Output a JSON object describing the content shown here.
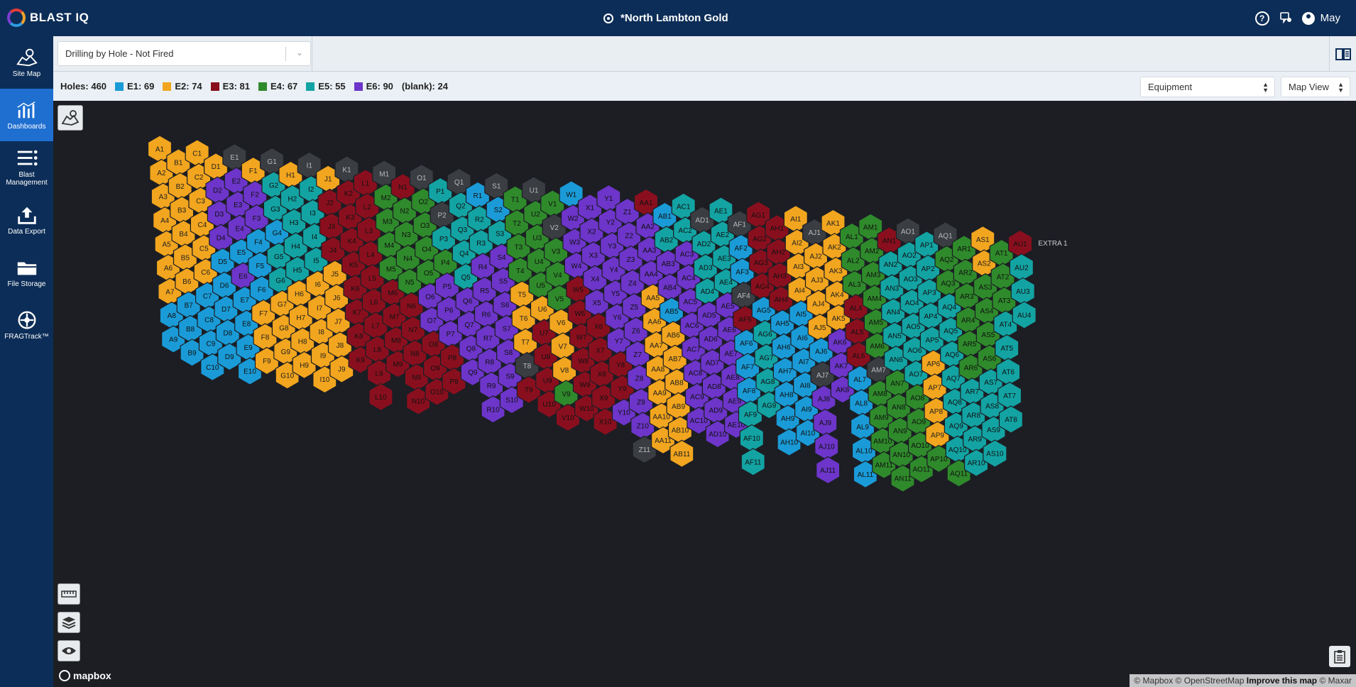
{
  "app": {
    "logo_text": "BLAST IQ",
    "site_title": "*North Lambton Gold",
    "user_name": "May"
  },
  "sidebar": {
    "items": [
      {
        "label": "Site Map",
        "icon": "map-icon",
        "active": false
      },
      {
        "label": "Dashboards",
        "icon": "chart-icon",
        "active": true
      },
      {
        "label": "Blast Management",
        "icon": "list-icon",
        "active": false
      },
      {
        "label": "Data Export",
        "icon": "upload-icon",
        "active": false
      },
      {
        "label": "File Storage",
        "icon": "folder-icon",
        "active": false
      },
      {
        "label": "FRAGTrack™",
        "icon": "target-icon",
        "active": false
      }
    ]
  },
  "toolbar": {
    "report": "Drilling by Hole - Not Fired"
  },
  "legend": {
    "holes": "Holes: 460",
    "items": [
      {
        "label": "E1: 69",
        "color": "#1a9bd7"
      },
      {
        "label": "E2: 74",
        "color": "#f2a51e"
      },
      {
        "label": "E3: 81",
        "color": "#8a0f1e"
      },
      {
        "label": "E4: 67",
        "color": "#2f8a2b"
      },
      {
        "label": "E5: 55",
        "color": "#13a3a3"
      },
      {
        "label": "E6: 90",
        "color": "#6d35c9"
      }
    ],
    "blank": "(blank): 24"
  },
  "selects": {
    "group": "Equipment",
    "view": "Map View"
  },
  "map": {
    "attribution": "© Mapbox © OpenStreetMap",
    "improve": "Improve this map",
    "maxar": "© Maxar",
    "mapbox_logo": "mapbox",
    "blank_color": "#3a3d42",
    "extra_label": "EXTRA 1",
    "rows": [
      {
        "p": "A",
        "n": 9,
        "s": "2222222111"
      },
      {
        "p": "B",
        "n": 9,
        "s": "2222221111"
      },
      {
        "p": "C",
        "n": 10,
        "s": "2222221111"
      },
      {
        "p": "D",
        "n": 9,
        "s": "2666111111"
      },
      {
        "p": "E",
        "n": 10,
        "s": "0666161111"
      },
      {
        "p": "F",
        "n": 9,
        "s": "2661112221"
      },
      {
        "p": "G",
        "n": 10,
        "s": "0551552222"
      },
      {
        "p": "H",
        "n": 9,
        "s": "2555522222"
      },
      {
        "p": "I",
        "n": 10,
        "s": "0555522222"
      },
      {
        "p": "J",
        "n": 9,
        "s": "2333222222"
      },
      {
        "p": "K",
        "n": 9,
        "s": "0333333333"
      },
      {
        "p": "L",
        "n": 10,
        "s": "3333333333"
      },
      {
        "p": "M",
        "n": 9,
        "s": "0444433333"
      },
      {
        "p": "N",
        "n": 10,
        "s": "3444433333"
      },
      {
        "p": "O",
        "n": 10,
        "s": "0444466333"
      },
      {
        "p": "P",
        "n": 9,
        "s": "5054666333"
      },
      {
        "p": "Q",
        "n": 9,
        "s": "0555566666"
      },
      {
        "p": "R",
        "n": 10,
        "s": "1556666666"
      },
      {
        "p": "S",
        "n": 10,
        "s": "0156666666"
      },
      {
        "p": "T",
        "n": 9,
        "s": "4444222033"
      },
      {
        "p": "U",
        "n": 10,
        "s": "0444423333"
      },
      {
        "p": "V",
        "n": 10,
        "s": "4044422243"
      },
      {
        "p": "W",
        "n": 10,
        "s": "1666333333"
      },
      {
        "p": "X",
        "n": 10,
        "s": "6666633333"
      },
      {
        "p": "Y",
        "n": 10,
        "s": "6666666336"
      },
      {
        "p": "Z",
        "n": 11,
        "s": "66666666660"
      },
      {
        "p": "AA",
        "n": 11,
        "s": "36662222222"
      },
      {
        "p": "AB",
        "n": 11,
        "s": "15661222222"
      },
      {
        "p": "AC",
        "n": 10,
        "s": "5566666666"
      },
      {
        "p": "AD",
        "n": 10,
        "s": "0555666666"
      },
      {
        "p": "AE",
        "n": 10,
        "s": "5555666666"
      },
      {
        "p": "AF",
        "n": 11,
        "s": "01103111555"
      },
      {
        "p": "AG",
        "n": 9,
        "s": "3333155555"
      },
      {
        "p": "AH",
        "n": 10,
        "s": "3333111111"
      },
      {
        "p": "AI",
        "n": 10,
        "s": "2222111111"
      },
      {
        "p": "AJ",
        "n": 11,
        "s": "02222106666"
      },
      {
        "p": "AK",
        "n": 8,
        "s": "2222266666"
      },
      {
        "p": "AL",
        "n": 11,
        "s": "44433311111"
      },
      {
        "p": "AM",
        "n": 11,
        "s": "44444404444"
      },
      {
        "p": "AN",
        "n": 11,
        "s": "35555544444"
      },
      {
        "p": "AO",
        "n": 11,
        "s": "05555554444"
      },
      {
        "p": "AP",
        "n": 10,
        "s": "5555522224"
      },
      {
        "p": "AQ",
        "n": 11,
        "s": "04455555554"
      },
      {
        "p": "AR",
        "n": 10,
        "s": "4444445555"
      },
      {
        "p": "AS",
        "n": 10,
        "s": "2244445555"
      },
      {
        "p": "AT",
        "n": 8,
        "s": "4445555555"
      },
      {
        "p": "AU",
        "n": 4,
        "s": "3555555555"
      }
    ]
  }
}
